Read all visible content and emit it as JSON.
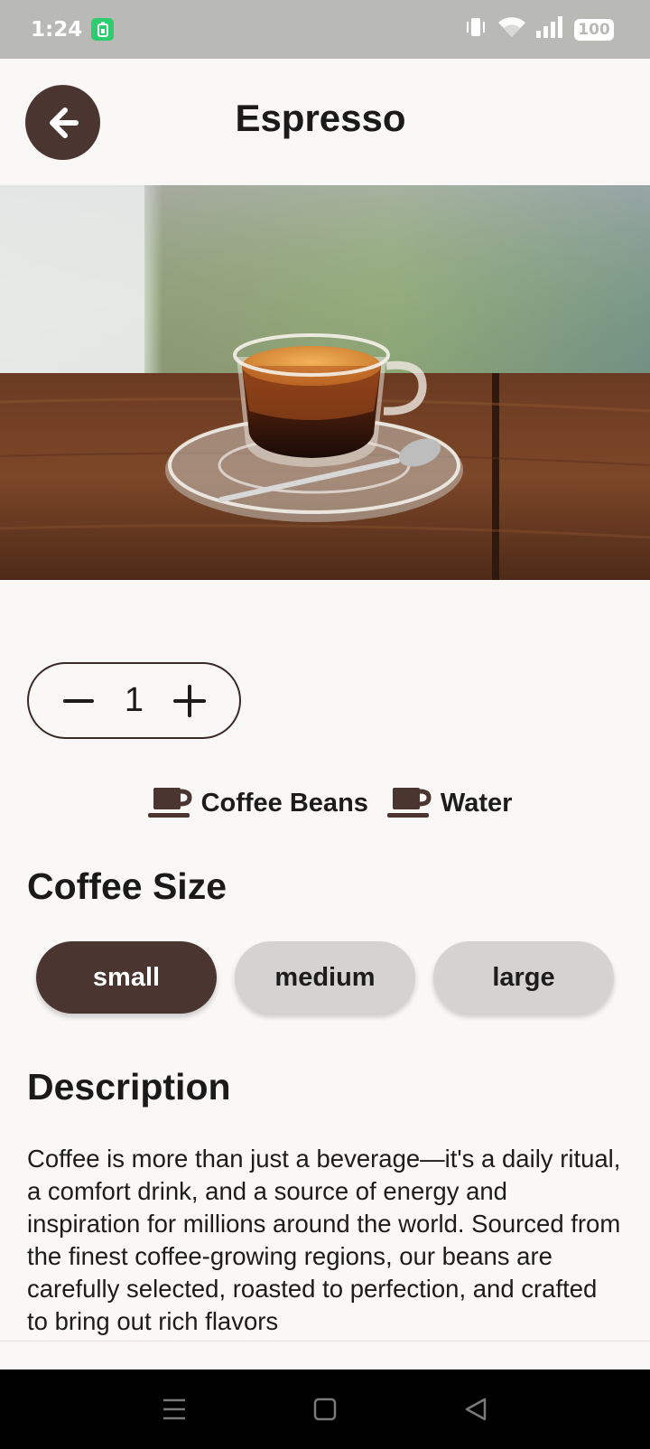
{
  "status_bar": {
    "time": "1:24",
    "battery": "100",
    "icons": [
      "battery-saver-icon",
      "vibrate-icon",
      "wifi-icon",
      "signal-icon",
      "battery-icon"
    ]
  },
  "header": {
    "back_icon": "arrow-left-icon",
    "title": "Espresso"
  },
  "hero": {
    "image": "espresso-cup-photo"
  },
  "quantity": {
    "decrement_icon": "minus-icon",
    "value": "1",
    "increment_icon": "plus-icon"
  },
  "ingredients": [
    {
      "icon": "coffee-cup-icon",
      "label": "Coffee Beans"
    },
    {
      "icon": "coffee-cup-icon",
      "label": "Water"
    }
  ],
  "coffee_size": {
    "title": "Coffee Size",
    "options": [
      {
        "label": "small",
        "selected": true
      },
      {
        "label": "medium",
        "selected": false
      },
      {
        "label": "large",
        "selected": false
      }
    ]
  },
  "description": {
    "title": "Description",
    "text": "Coffee is more than just a beverage—it's a daily ritual, a comfort drink, and a source of energy and inspiration for millions around the world. Sourced from the finest coffee-growing regions, our beans are carefully selected, roasted to perfection, and crafted to bring out rich flavors"
  },
  "colors": {
    "primary_brown": "#4a3530",
    "background": "#f9f8f6",
    "chip_unselected": "#d4d3d1",
    "status_bar": "#b9bab6"
  },
  "nav_bar": {
    "icons": [
      "menu-icon",
      "home-icon",
      "back-icon"
    ]
  }
}
